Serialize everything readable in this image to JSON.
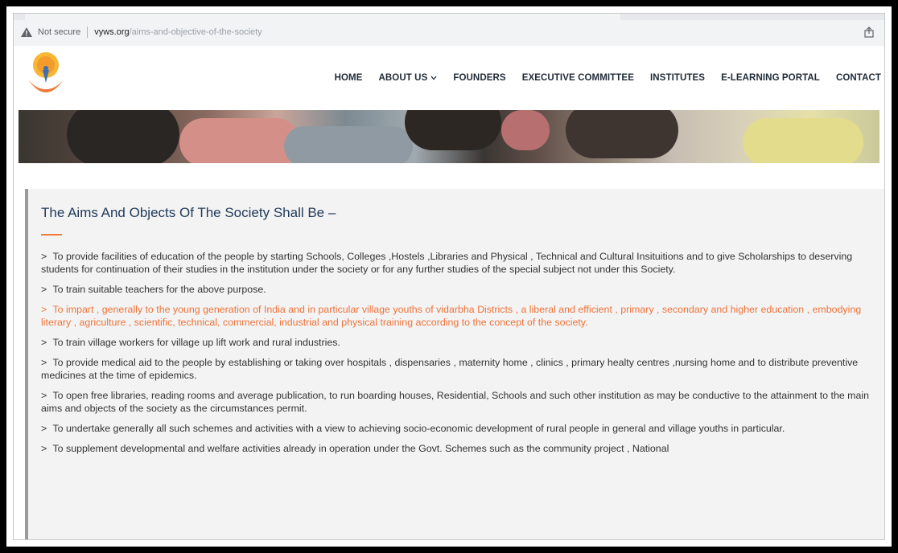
{
  "browser": {
    "security_label": "Not secure",
    "url_domain": "vyws.org",
    "url_path": "/aims-and-objective-of-the-society",
    "icons": [
      "warning-icon",
      "share-icon"
    ]
  },
  "nav": {
    "items": [
      {
        "label": "HOME"
      },
      {
        "label": "ABOUT US"
      },
      {
        "label": "FOUNDERS"
      },
      {
        "label": "EXECUTIVE COMMITTEE"
      },
      {
        "label": "INSTITUTES"
      },
      {
        "label": "E-LEARNING PORTAL"
      },
      {
        "label": "CONTACT"
      }
    ]
  },
  "main": {
    "title": "The Aims And Objects Of The Society Shall Be –",
    "aims": [
      {
        "text": "To provide facilities of education of the people by starting Schools, Colleges ,Hostels ,Libraries and Physical , Technical and Cultural Insituitions and to give Scholarships to deserving students for continuation of their studies in the institution under the society or for any further studies of the special subject not under this Society."
      },
      {
        "text": "To train suitable teachers for the above purpose."
      },
      {
        "text": "To impart , generally to the young generation of India and in particular village youths of vidarbha Districts , a liberal and efficient , primary , secondary and higher education , embodying literary , agriculture , scientific, technical, commercial, industrial and physical training according to the concept of the society."
      },
      {
        "text": "To train village workers for village up lift work and rural industries."
      },
      {
        "text": "To provide medical aid to the people by establishing or taking over hospitals , dispensaries , maternity home , clinics , primary healty centres ,nursing home and to distribute preventive medicines at the time of epidemics."
      },
      {
        "text": "To open free libraries, reading rooms and average publication, to run boarding houses, Residential, Schools and such other institution as may be conductive to the attainment to the main aims and objects of the society as the circumstances permit."
      },
      {
        "text": "To undertake generally all such schemes and activities with a view to achieving socio-economic development of rural people in general and village youths in particular."
      },
      {
        "text": "To supplement developmental and welfare activities already in operation under the Govt. Schemes such as the community project , National"
      }
    ],
    "bullet": ">"
  },
  "colors": {
    "accent": "#f0733a",
    "title": "#1f3a5a",
    "body_text": "#333333",
    "content_bg": "#f3f3f3",
    "frame": "#000000"
  }
}
